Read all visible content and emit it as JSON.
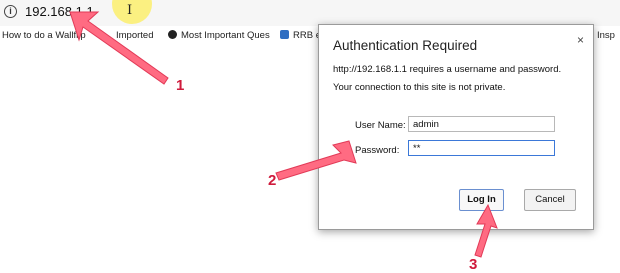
{
  "browser": {
    "url": "192.168.1.1",
    "info_icon_glyph": "i",
    "cursor_glyph": "I",
    "bookmarks": [
      {
        "label": "How to do a Wallflip",
        "icon": "none"
      },
      {
        "label": "Imported",
        "icon": "folder-icon"
      },
      {
        "label": "Most Important Ques",
        "icon": "quiz-icon"
      },
      {
        "label": "RRB e",
        "icon": "bookmark-blue-icon"
      },
      {
        "label": "Insp",
        "icon": "none"
      }
    ]
  },
  "dialog": {
    "title": "Authentication Required",
    "close_glyph": "×",
    "message_line1": "http://192.168.1.1 requires a username and password.",
    "message_line2": "Your connection to this site is not private.",
    "username_label": "User Name:",
    "username_value": "admin",
    "password_label": "Password:",
    "password_value": "**",
    "login_label": "Log In",
    "cancel_label": "Cancel"
  },
  "annotations": {
    "color": "#cf1b3c",
    "steps": [
      "1",
      "2",
      "3"
    ]
  }
}
